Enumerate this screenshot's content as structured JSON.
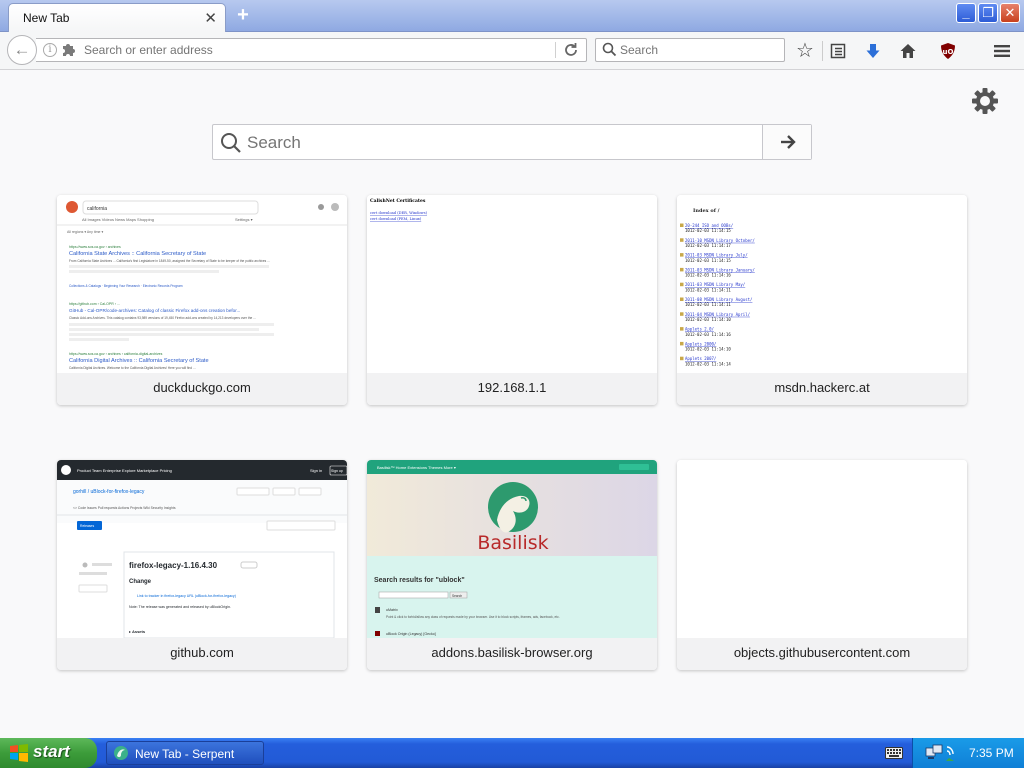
{
  "browser": {
    "tab_title": "New Tab",
    "tab_close_glyph": "✕",
    "new_tab_glyph": "+",
    "window_buttons": {
      "minimize": "_",
      "maximize": "❐",
      "close": "✕"
    }
  },
  "navbar": {
    "url_placeholder": "Search or enter address",
    "search_placeholder": "Search"
  },
  "newtab": {
    "search_placeholder": "Search",
    "tiles": [
      {
        "title": "duckduckgo.com"
      },
      {
        "title": "192.168.1.1"
      },
      {
        "title": "msdn.hackerc.at"
      },
      {
        "title": "github.com"
      },
      {
        "title": "addons.basilisk-browser.org"
      },
      {
        "title": "objects.githubusercontent.com"
      }
    ]
  },
  "thumbs": {
    "ddg": {
      "query": "california",
      "tabs": "All   Images   Videos   News   Maps   Shopping",
      "settings": "Settings ▾",
      "filters": "All regions ▾   Any time ▾",
      "r1_url": "https://www.sos.ca.gov › archives",
      "r1_title": "California State Archives :: California Secretary of State",
      "r1_snip": "From California State Archives ... California's first Legislature in 1849-50, assigned the Secretary of State to be keeper of the public archives ...",
      "r1_links": "Collections & Catalogs · Beginning Your Research · Electronic Records Program",
      "r2_url": "https://github.com › Cal-OPR › ...",
      "r2_title": "GitHub - Cal-OPR/code-archives: Catalog of classic Firefox add-ons creation befor...",
      "r2_snip": "Classic Add-ons Archives. This catalog contains 93,989 versions of 19,450 Firefox add-ons created by 14,213 developers over the ...",
      "r3_url": "https://www.sos.ca.gov › archives › california-digital-archives",
      "r3_title": "California Digital Archives :: California Secretary of State",
      "r3_snip": "California Digital Archives. Welcome to the California Digital Archives! Here you will find ..."
    },
    "router": {
      "heading": "CalishNet Certificates",
      "link1": "cert download (DER, Windows)",
      "link2": "cert download (PEM, Linux)"
    },
    "msdn": {
      "heading": "Index of /",
      "entries": [
        "20-244 ISO and OOBs/",
        "1012-02-03 11:14:15",
        "2011-10 MSDN Library October/",
        "1012-02-03 11:14:17",
        "2011-03 MSDN Library July/",
        "1012-02-03 11:14:15",
        "2011-03 MSDN Library January/",
        "1012-02-03 11:14:16",
        "2011-03 MSDN Library May/",
        "1012-02-03 11:14:11",
        "2011-08 MSDN Library August/",
        "1012-02-03 11:14:11",
        "2011-04 MSDN Library April/",
        "1012-02-03 11:14:10",
        "Applets 2.0/",
        "1012-02-03 11:14:16",
        "Applets 2000/",
        "1012-02-03 11:14:10",
        "Applets 2007/",
        "1012-02-03 11:14:14"
      ]
    },
    "github": {
      "nav": "Product   Team   Enterprise   Explore   Marketplace   Pricing",
      "signin": "Sign in",
      "signup": "Sign up",
      "repo": "gorhill / uBlock-for-firefox-legacy",
      "repo_tabs": "<> Code   Issues   Pull requests   Actions   Projects   Wiki   Security   Insights",
      "release_btn": "Releases",
      "release_title": "firefox-legacy-1.16.4.30",
      "changes": "Change",
      "bullet": "Link to tracker in firefox-legacy URL (uBlock-for-firefox-legacy)",
      "note": "Note: The release was generated and released by uBlockOrigin.",
      "assets": "▸ Assets"
    },
    "basilisk": {
      "nav": "Basilisk™   Home   Extensions   Themes   More ▾",
      "brand": "Basilisk",
      "results": "Search results for \"ublock\"",
      "item1": "uMatrix",
      "item1_desc": "Point & click to forbid/allow any class of requests made by your browser. Use it to block scripts, iframes, ads, facebook, etc.",
      "item2": "uBlock Origin (Legacy) [Gecko]",
      "search_btn": "Search"
    }
  },
  "taskbar": {
    "start_label": "start",
    "window_label": "New Tab - Serpent",
    "clock": "7:35 PM"
  }
}
